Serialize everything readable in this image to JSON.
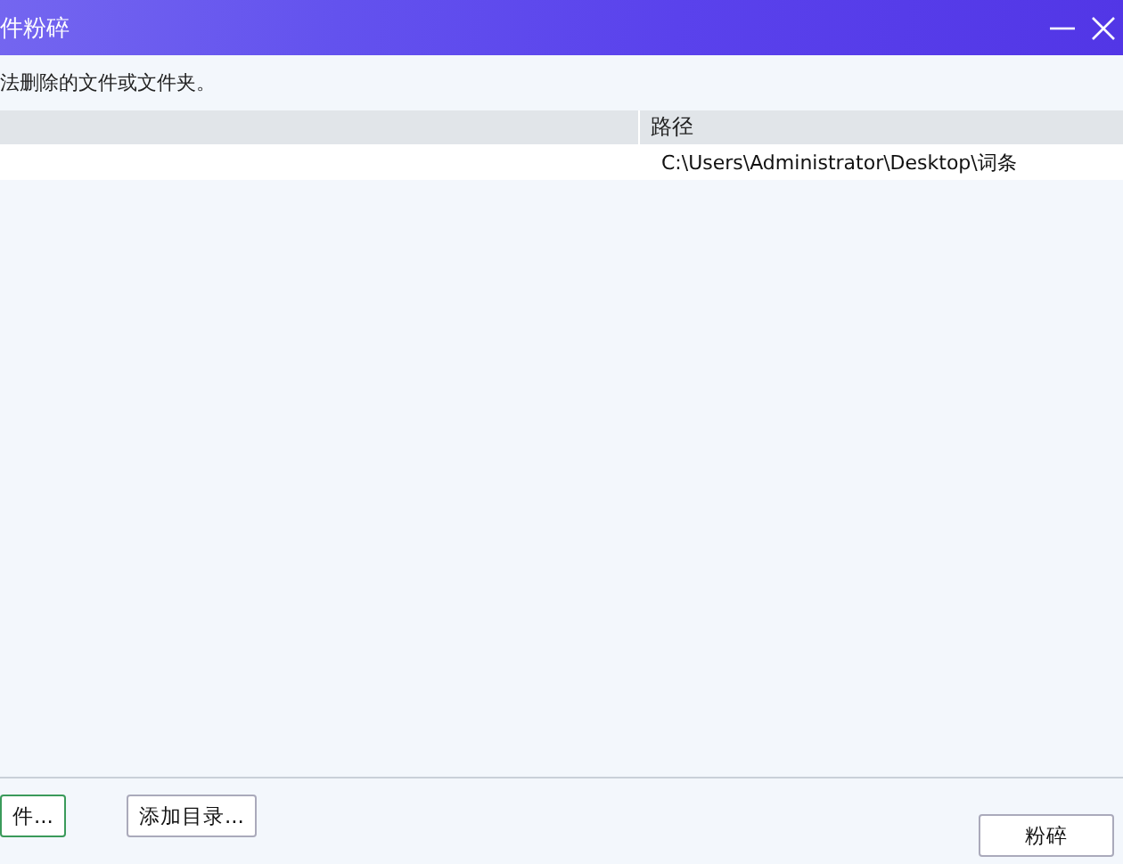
{
  "window": {
    "title": "件粉碎"
  },
  "description": "法删除的文件或文件夹。",
  "table": {
    "columns": [
      "路径"
    ],
    "rows": [
      {
        "path": "C:\\Users\\Administrator\\Desktop\\词条"
      }
    ]
  },
  "buttons": [
    {
      "label": "件...",
      "kind": "focused"
    },
    {
      "label": "添加目录...",
      "kind": "normal"
    }
  ],
  "action_button": {
    "label": "粉碎"
  }
}
